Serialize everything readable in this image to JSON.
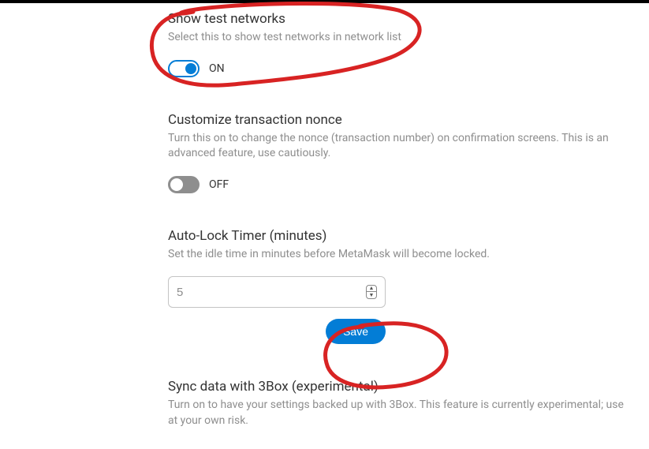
{
  "settings": {
    "showTestNetworks": {
      "title": "Show test networks",
      "desc": "Select this to show test networks in network list",
      "state": "ON"
    },
    "customizeNonce": {
      "title": "Customize transaction nonce",
      "desc": "Turn this on to change the nonce (transaction number) on confirmation screens. This is an advanced feature, use cautiously.",
      "state": "OFF"
    },
    "autoLock": {
      "title": "Auto-Lock Timer (minutes)",
      "desc": "Set the idle time in minutes before MetaMask will become locked.",
      "value": "5",
      "saveLabel": "Save"
    },
    "sync3box": {
      "title": "Sync data with 3Box (experimental)",
      "desc": "Turn on to have your settings backed up with 3Box. This feature is currently experimental; use at your own risk."
    }
  }
}
